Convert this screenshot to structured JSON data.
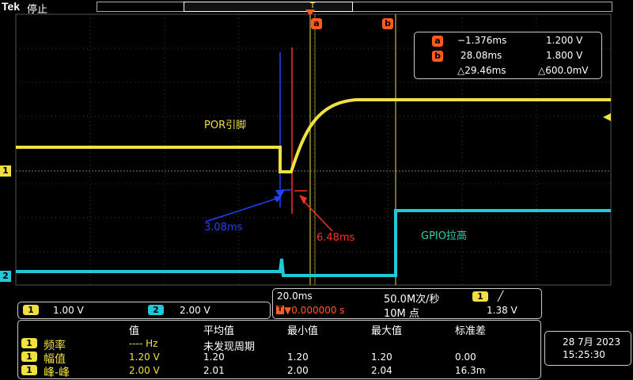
{
  "header": {
    "brand": "Tek",
    "status": "停止",
    "trigger_marker": "T"
  },
  "cursors": {
    "a": {
      "label": "a",
      "time": "−1.376ms",
      "volt": "1.200 V"
    },
    "b": {
      "label": "b",
      "time": "28.08ms",
      "volt": "1.800 V"
    },
    "delta_time": "△29.46ms",
    "delta_volt": "△600.0mV"
  },
  "annotations": {
    "por_label": "POR引脚",
    "blue_delay": "3.08ms",
    "red_delay": "6.48ms",
    "gpio_label": "GPIO拉高"
  },
  "channels": {
    "ch1": {
      "id": "1",
      "scale": "1.00 V",
      "color": "#f0e040"
    },
    "ch2": {
      "id": "2",
      "scale": "2.00 V",
      "color": "#20c8d8"
    }
  },
  "timebase": {
    "scale": "20.0ms",
    "sample_rate": "50.0M次/秒",
    "trig_pos": "▼0.000000 s",
    "record": "10M 点",
    "trig_channel": "1",
    "trig_slope": "╱",
    "trig_level": "1.38 V"
  },
  "measurements": {
    "headers": [
      "值",
      "平均值",
      "最小值",
      "最大值",
      "标准差"
    ],
    "rows": [
      {
        "ch": "1",
        "name": "频率",
        "value": "---- Hz",
        "mean": "未发现周期",
        "min": "",
        "max": "",
        "std": ""
      },
      {
        "ch": "1",
        "name": "幅值",
        "value": "1.20 V",
        "mean": "1.20",
        "min": "1.20",
        "max": "1.20",
        "std": "0.00"
      },
      {
        "ch": "1",
        "name": "峰-峰",
        "value": "2.00 V",
        "mean": "2.01",
        "min": "2.00",
        "max": "2.04",
        "std": "16.3m"
      }
    ]
  },
  "datetime": {
    "date": "28 7月 2023",
    "time": "15:25:30"
  },
  "colors": {
    "ch1": "#f0e040",
    "ch2": "#20c8d8",
    "cursor_marker": "#ff5a20",
    "annotation_blue": "#2040ff",
    "annotation_red": "#ff3020"
  }
}
